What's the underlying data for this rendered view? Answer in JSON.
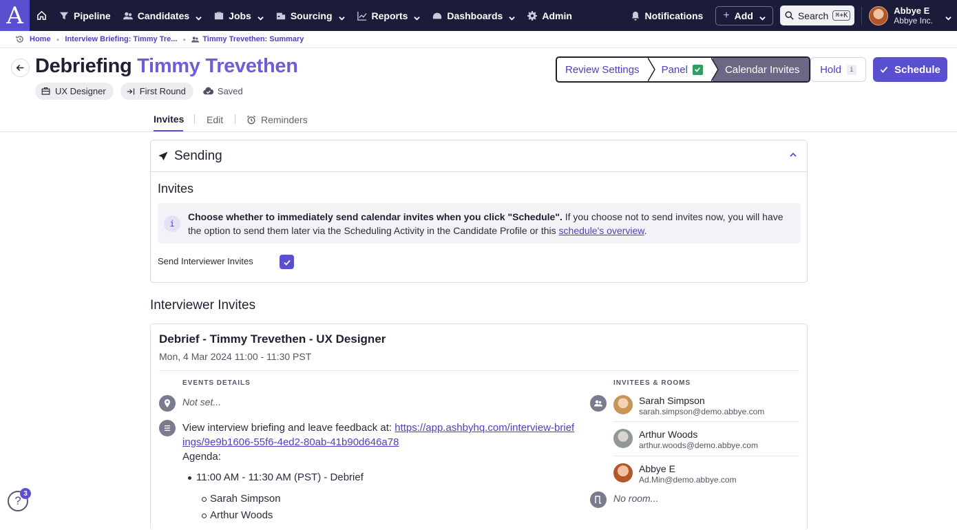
{
  "nav": {
    "logo": "A",
    "items": [
      {
        "label": "Pipeline",
        "icon": "funnel-icon",
        "dropdown": false
      },
      {
        "label": "Candidates",
        "icon": "people-icon",
        "dropdown": true
      },
      {
        "label": "Jobs",
        "icon": "briefcase-icon",
        "dropdown": true
      },
      {
        "label": "Sourcing",
        "icon": "sourcing-icon",
        "dropdown": true
      },
      {
        "label": "Reports",
        "icon": "chart-line-icon",
        "dropdown": true
      },
      {
        "label": "Dashboards",
        "icon": "gauge-icon",
        "dropdown": true
      },
      {
        "label": "Admin",
        "icon": "gear-icon",
        "dropdown": false
      }
    ],
    "notifications": "Notifications",
    "add": "Add",
    "search": "Search",
    "shortcut": "⌘+K",
    "user_name": "Abbye E",
    "user_company": "Abbye Inc."
  },
  "breadcrumb": {
    "home": "Home",
    "item2": "Interview Briefing: Timmy Tre...",
    "item3": "Timmy Trevethen: Summary"
  },
  "header": {
    "title_prefix": "Debriefing",
    "candidate": "Timmy Trevethen",
    "chip_role": "UX Designer",
    "chip_stage": "First Round",
    "saved": "Saved"
  },
  "stepper": {
    "step1": "Review Settings",
    "step2": "Panel",
    "step3": "Calendar Invites"
  },
  "actions": {
    "hold": "Hold",
    "hold_badge": "i",
    "schedule": "Schedule"
  },
  "tabs": {
    "invites": "Invites",
    "edit": "Edit",
    "reminders": "Reminders"
  },
  "sending": {
    "title": "Sending",
    "subheading": "Invites",
    "info_bold": "Choose whether to immediately send calendar invites when you click \"Schedule\".",
    "info_rest": " If you choose not to send invites now, you will have the option to send them later via the Scheduling Activity in the Candidate Profile or this ",
    "info_link": "schedule's overview",
    "info_end": ".",
    "info_icon": "i",
    "send_label": "Send Interviewer Invites",
    "send_checked": true
  },
  "interviewer_invites": {
    "heading": "Interviewer Invites",
    "event_title": "Debrief - Timmy Trevethen - UX Designer",
    "event_date": "Mon, 4 Mar 2024 11:00 - 11:30 PST",
    "events_label": "EVENTS DETAILS",
    "location": "Not set...",
    "desc_text": "View interview briefing and leave feedback at: ",
    "desc_link": "https://app.ashbyhq.com/interview-briefings/9e9b1606-55f6-4ed2-80ab-41b90d646a78",
    "agenda_label": "Agenda:",
    "agenda_item": "11:00 AM - 11:30 AM (PST) - Debrief",
    "agenda_people": [
      "Sarah Simpson",
      "Arthur Woods"
    ],
    "invitees_label": "INVITEES & ROOMS",
    "invitees": [
      {
        "name": "Sarah Simpson",
        "email": "sarah.simpson@demo.abbye.com"
      },
      {
        "name": "Arthur Woods",
        "email": "arthur.woods@demo.abbye.com"
      },
      {
        "name": "Abbye E",
        "email": "Ad.Min@demo.abbye.com"
      }
    ],
    "no_room": "No room..."
  },
  "help": {
    "icon": "?",
    "badge": "3"
  },
  "colors": {
    "nav_bg": "#1b1c3a",
    "accent": "#5a4fcf",
    "candidate": "#6b5ed6",
    "success": "#2f9e62"
  }
}
